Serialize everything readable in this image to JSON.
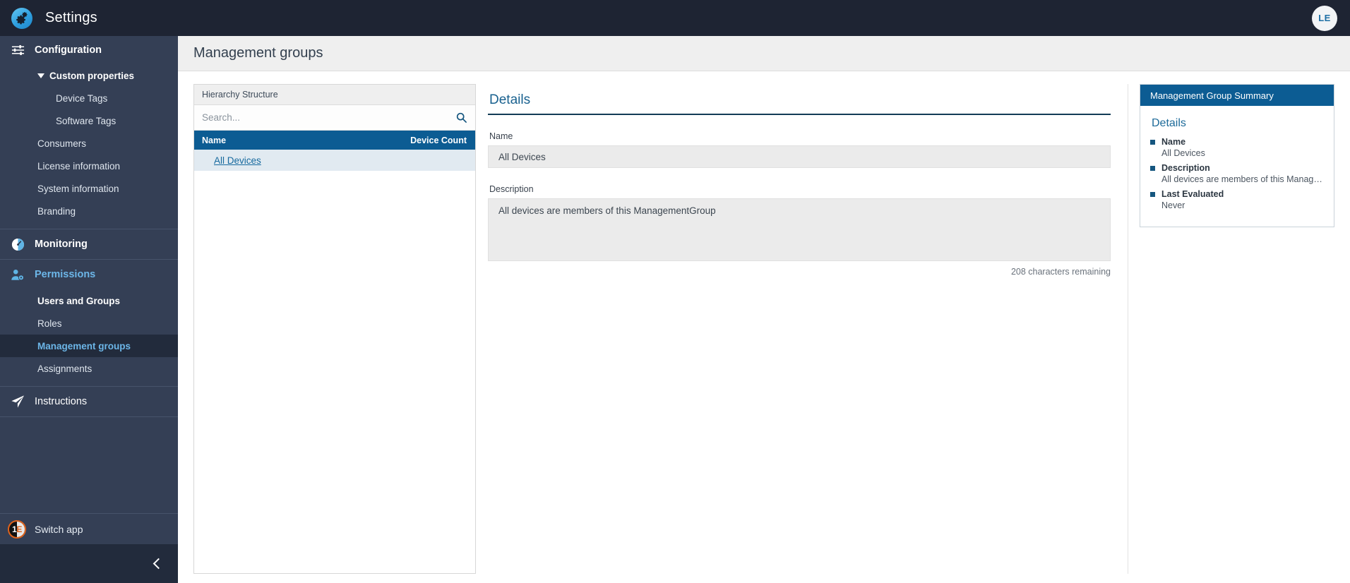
{
  "topbar": {
    "logo_icon": "gears-icon",
    "title": "Settings",
    "avatar_initials": "LE"
  },
  "sidebar": {
    "groups": [
      {
        "label": "Configuration",
        "icon": "sliders-icon",
        "items": [
          {
            "label": "Custom properties",
            "level": 1,
            "expanded": true,
            "style": "expander"
          },
          {
            "label": "Device Tags",
            "level": 2,
            "style": "normal"
          },
          {
            "label": "Software Tags",
            "level": 2,
            "style": "normal"
          },
          {
            "label": "Consumers",
            "level": 1,
            "style": "normal"
          },
          {
            "label": "License information",
            "level": 1,
            "style": "normal"
          },
          {
            "label": "System information",
            "level": 1,
            "style": "normal"
          },
          {
            "label": "Branding",
            "level": 1,
            "style": "normal"
          }
        ]
      },
      {
        "label": "Monitoring",
        "icon": "gauge-icon",
        "items": []
      },
      {
        "label": "Permissions",
        "icon": "user-gear-icon",
        "active": true,
        "items": [
          {
            "label": "Users and Groups",
            "level": 1,
            "style": "bold"
          },
          {
            "label": "Roles",
            "level": 1,
            "style": "normal"
          },
          {
            "label": "Management groups",
            "level": 1,
            "style": "selected"
          },
          {
            "label": "Assignments",
            "level": 1,
            "style": "normal"
          }
        ]
      },
      {
        "label": "Instructions",
        "icon": "paper-plane-icon",
        "items": []
      }
    ],
    "switch_app": {
      "label": "Switch app",
      "logo_icon": "one-e-logo",
      "logo_text_1": "1",
      "logo_text_2": "E"
    },
    "collapse_icon": "chevron-left-icon"
  },
  "page": {
    "title": "Management groups"
  },
  "hierarchy": {
    "panel_title": "Hierarchy Structure",
    "search": {
      "placeholder": "Search...",
      "value": "",
      "icon": "search-icon"
    },
    "columns": [
      "Name",
      "Device Count"
    ],
    "rows": [
      {
        "name": "All Devices",
        "device_count": ""
      }
    ]
  },
  "details": {
    "title": "Details",
    "name_label": "Name",
    "name_value": "All Devices",
    "description_label": "Description",
    "description_value": "All devices are members of this ManagementGroup",
    "char_count": "208 characters remaining"
  },
  "summary": {
    "header": "Management Group Summary",
    "heading": "Details",
    "items": [
      {
        "key": "Name",
        "value": "All Devices"
      },
      {
        "key": "Description",
        "value": "All devices are members of this Manag…"
      },
      {
        "key": "Last Evaluated",
        "value": "Never"
      }
    ]
  },
  "colors": {
    "sidebar_bg": "#343f55",
    "topbar_bg": "#1e2433",
    "accent_blue": "#0c5c93",
    "link_blue": "#16699e",
    "selected_row": "#e1eaf1"
  }
}
